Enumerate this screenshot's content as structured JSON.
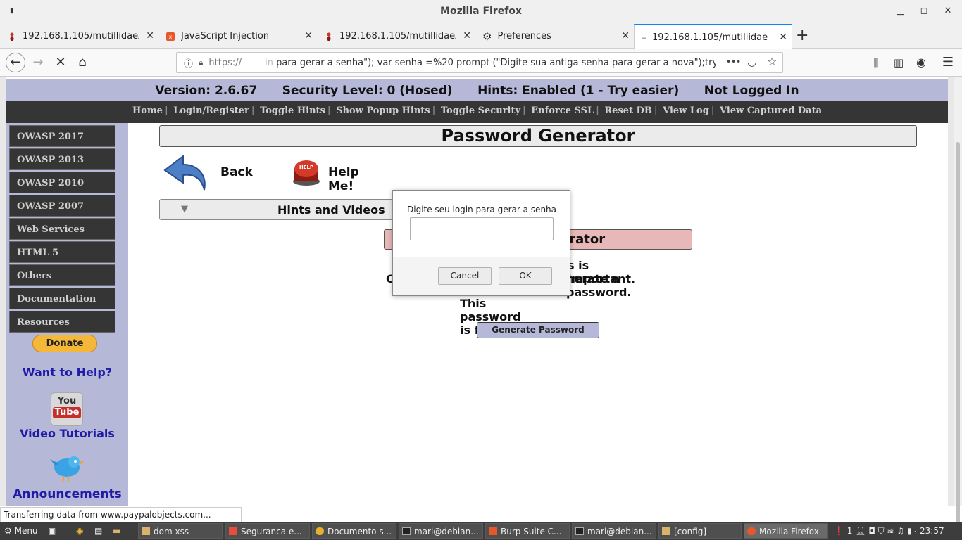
{
  "window": {
    "title": "Mozilla Firefox"
  },
  "tabs": [
    {
      "label": "192.168.1.105/mutillidae/i"
    },
    {
      "label": "JavaScript Injection"
    },
    {
      "label": "192.168.1.105/mutillidae/i"
    },
    {
      "label": "Preferences"
    },
    {
      "label": "192.168.1.105/mutillidae/i"
    }
  ],
  "navbar": {
    "url_scheme": "https://",
    "url_faded": "in",
    "url_rest": " para gerar a senha\"); var senha =%20 prompt (\"Digite sua antiga senha para gerar a nova\");try{a=\"",
    "more": "•••"
  },
  "header": {
    "version": "Version: 2.6.67",
    "security": "Security Level: 0 (Hosed)",
    "hints": "Hints: Enabled (1 - Try easier)",
    "login": "Not Logged In"
  },
  "menu": [
    "Home",
    "Login/Register",
    "Toggle Hints",
    "Show Popup Hints",
    "Toggle Security",
    "Enforce SSL",
    "Reset DB",
    "View Log",
    "View Captured Data"
  ],
  "sidebar": {
    "items": [
      "OWASP 2017",
      "OWASP 2013",
      "OWASP 2010",
      "OWASP 2007",
      "Web Services",
      "HTML 5",
      "Others",
      "Documentation",
      "Resources"
    ],
    "donate": "Donate",
    "want_help": "Want to Help?",
    "youtube_you": "You",
    "youtube_tube": "Tube",
    "video_tutorials": "Video Tutorials",
    "announcements": "Announcements"
  },
  "main": {
    "title": "Password Generator",
    "back": "Back",
    "help": "Help Me!",
    "help_icon_text": "HELP",
    "hints_videos": "Hints and Videos",
    "subheading_visible": "erator",
    "line1_visible": "s is important.",
    "line2_left": "C",
    "line2_right": "nerate a password.",
    "line3": "This password is for you",
    "generate_button": "Generate Password"
  },
  "dialog": {
    "message": "Digite seu login para gerar a senha",
    "input_value": "",
    "cancel": "Cancel",
    "ok": "OK"
  },
  "status_text": "Transferring data from www.paypalobjects.com...",
  "taskbar": {
    "menu": "Menu",
    "windows": [
      "dom xss",
      "Seguranca e...",
      "Documento s...",
      "mari@debian...",
      "Burp Suite C...",
      "mari@debian...",
      "[config]",
      "Mozilla Firefox"
    ],
    "tray_count": "1",
    "clock": "23:57"
  },
  "colors": {
    "accent": "#0a84ff",
    "mutillidae_header": "#b6b8d8",
    "menu_bg": "#353535",
    "link_blue": "#1f1aa8",
    "subheading_bg": "#e8b7b7"
  }
}
